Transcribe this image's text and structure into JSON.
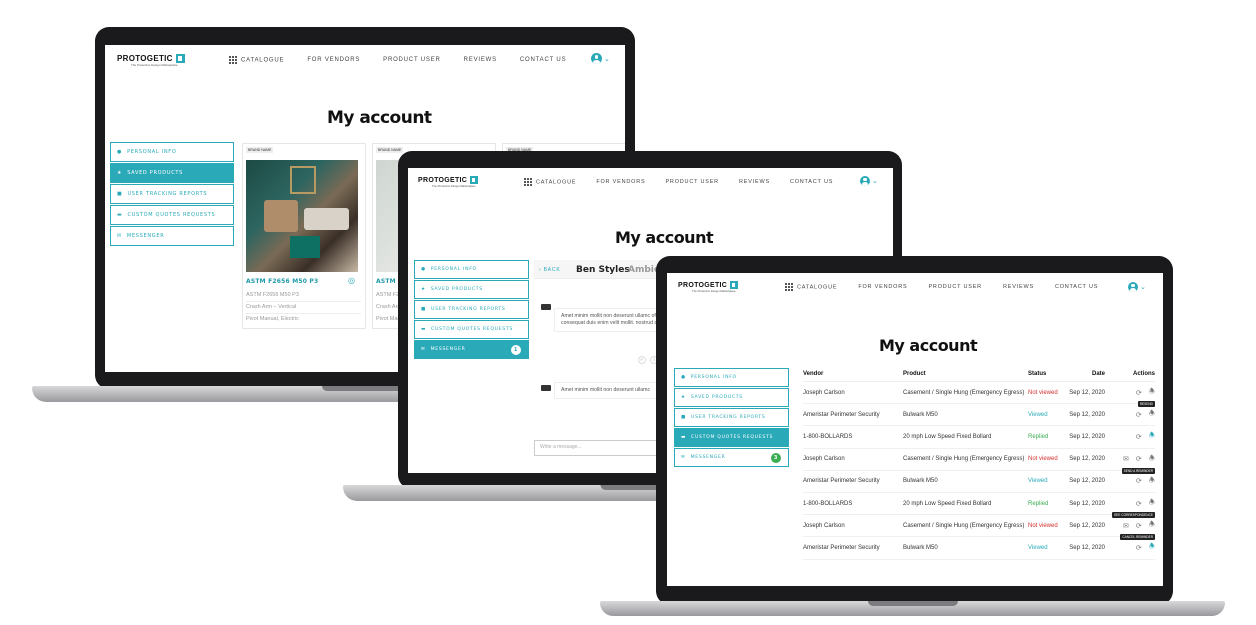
{
  "brand": {
    "logo_text": "PROTOGETIC",
    "tagline": "The Protective Design Marketplace"
  },
  "nav": {
    "catalogue": "CATALOGUE",
    "for_vendors": "FOR VENDORS",
    "product_user": "PRODUCT USER",
    "reviews": "REVIEWS",
    "contact_us": "CONTACT US"
  },
  "page_title": "My account",
  "menu": {
    "personal_info": "PERSONAL INFO",
    "saved_products": "SAVED PRODUCTS",
    "user_tracking_reports": "USER TRACKING REPORTS",
    "custom_quotes_requests": "CUSTOM QUOTES REQUESTS",
    "messenger": "MESSENGER"
  },
  "messenger_badge": "1",
  "messenger_badge_green": "3",
  "saved_products": {
    "cards": [
      {
        "brand": "BRAND NAME",
        "name": "ASTM F2656 M50 P3",
        "lines": [
          "ASTM F2656 M50 P3",
          "Crash Arm – Vertical",
          "Pivot Manual, Electric"
        ]
      },
      {
        "brand": "BRAND NAME",
        "name": "ASTM F2656 M50 P3",
        "lines": [
          "ASTM F265",
          "Crash Arm",
          "Pivot Man"
        ]
      },
      {
        "brand": "BRAND NAME"
      }
    ]
  },
  "messenger": {
    "back": "BACK",
    "contact_name": "Ben Styles",
    "product": "Ambico, Blast D",
    "message_1": "Amet minim mollit non deserunt ullamc officia consequat duis enim velit mollit. nostrud amet.",
    "message_2": "Amet minim mollit non deserunt ullamc",
    "input_placeholder": "Write a message..."
  },
  "quotes": {
    "headers": {
      "vendor": "Vendor",
      "product": "Product",
      "status": "Status",
      "date": "Date",
      "actions": "Actions"
    },
    "rows": [
      {
        "vendor": "Joseph Carlson",
        "product": "Casement / Single Hung (Emergency Egress)",
        "status": "Not viewed",
        "status_color": "#d32f2f",
        "date": "Sep 12, 2020",
        "tooltip": ""
      },
      {
        "vendor": "Ameristar Perimeter Security",
        "product": "Bulwark M50",
        "status": "Viewed",
        "status_color": "#2aaab9",
        "date": "Sep 12, 2020",
        "tooltip": "RESEND"
      },
      {
        "vendor": "1-800-BOLLARDS",
        "product": "20 mph Low Speed Fixed Bollard",
        "status": "Replied",
        "status_color": "#3cae52",
        "date": "Sep 12, 2020",
        "tooltip": ""
      },
      {
        "vendor": "Joseph Carlson",
        "product": "Casement / Single Hung (Emergency Egress)",
        "status": "Not viewed",
        "status_color": "#d32f2f",
        "date": "Sep 12, 2020",
        "tooltip": ""
      },
      {
        "vendor": "Ameristar Perimeter Security",
        "product": "Bulwark M50",
        "status": "Viewed",
        "status_color": "#2aaab9",
        "date": "Sep 12, 2020",
        "tooltip": "SEND A REMINDER"
      },
      {
        "vendor": "1-800-BOLLARDS",
        "product": "20 mph Low Speed Fixed Bollard",
        "status": "Replied",
        "status_color": "#3cae52",
        "date": "Sep 12, 2020",
        "tooltip": ""
      },
      {
        "vendor": "Joseph Carlson",
        "product": "Casement / Single Hung (Emergency Egress)",
        "status": "Not viewed",
        "status_color": "#d32f2f",
        "date": "Sep 12, 2020",
        "tooltip": "SEE CORRESPONDENCE"
      },
      {
        "vendor": "Ameristar Perimeter Security",
        "product": "Bulwark M50",
        "status": "Viewed",
        "status_color": "#2aaab9",
        "date": "Sep 12, 2020",
        "tooltip": "CANCEL REMINDER"
      }
    ]
  },
  "colors": {
    "accent": "#2aaab9",
    "not_viewed": "#d32f2f",
    "replied": "#3cae52",
    "laptop_frame": "#1a1a1c"
  }
}
